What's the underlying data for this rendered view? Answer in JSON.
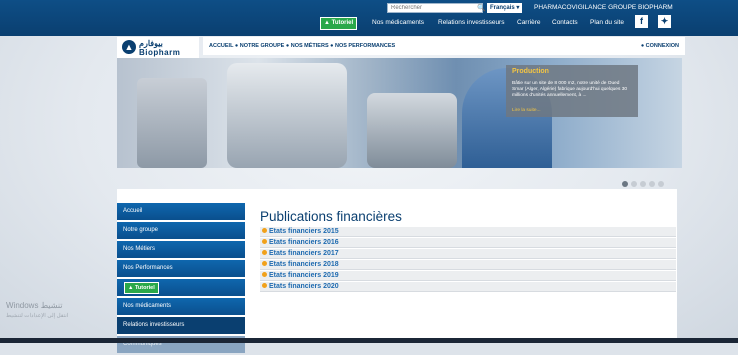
{
  "topbar": {
    "search_placeholder": "Rechercher",
    "language": "Français",
    "links": [
      "PHARMACOVIGILANCE",
      "GROUPE BIOPHARM"
    ],
    "tutorial_label": "Tutoriel",
    "nav": [
      "Nos médicaments",
      "Relations investisseurs",
      "Carrière",
      "Contacts",
      "Plan du site"
    ],
    "social": [
      "facebook-icon",
      "twitter-icon"
    ]
  },
  "header": {
    "logo_ar": "بيوفارم",
    "logo_en": "Biopharm",
    "breadcrumb": "ACCUEIL  ●  NOTRE GROUPE  ●  NOS MÉTIERS  ●  NOS PERFORMANCES",
    "connexion": "● CONNEXION"
  },
  "banner": {
    "title": "Production",
    "text": "Bâtie sur un site de 8 000 m2, notre unité de Oued Smar (Alger, Algérie) fabrique aujourd'hui quelques 30 millions d'unités annuellement, à ...",
    "more": "Lire la suite..."
  },
  "sidebar": {
    "items": [
      "Accueil",
      "Notre groupe",
      "Nos Métiers",
      "Nos Performances"
    ],
    "tutorial_label": "Tutoriel",
    "items2": [
      "Nos médicaments",
      "Relations investisseurs",
      "Communiqués"
    ]
  },
  "main": {
    "title": "Publications financières",
    "items": [
      "Etats financiers 2015",
      "Etats financiers 2016",
      "Etats financiers 2017",
      "Etats financiers 2018",
      "Etats financiers 2019",
      "Etats financiers 2020"
    ]
  },
  "watermark": {
    "line1": "Windows تنشيط",
    "line2": "انتقل إلى الإعدادات لتنشيط"
  }
}
